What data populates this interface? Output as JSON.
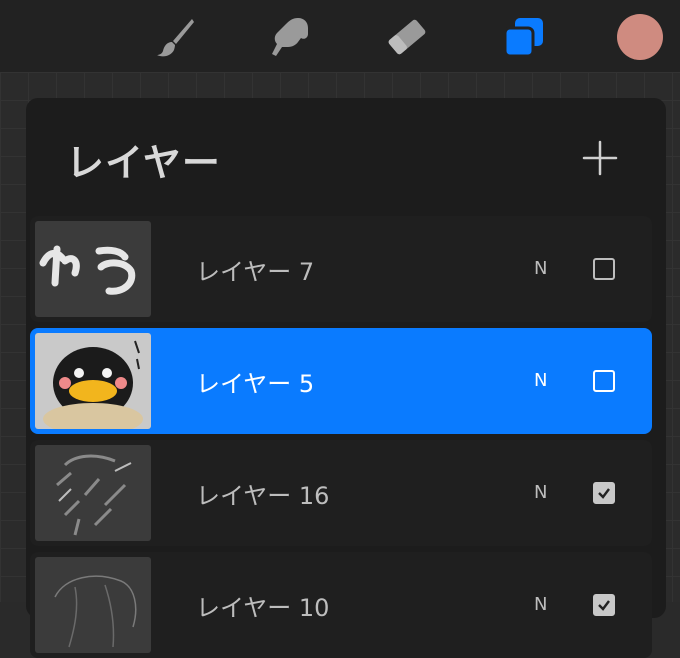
{
  "toolbar": {
    "tools": [
      {
        "name": "brush",
        "icon": "brush-icon",
        "active": false
      },
      {
        "name": "smudge",
        "icon": "smudge-icon",
        "active": false
      },
      {
        "name": "eraser",
        "icon": "eraser-icon",
        "active": false
      },
      {
        "name": "layers",
        "icon": "layers-icon",
        "active": true
      }
    ],
    "current_color": "#cf8b80",
    "active_color": "#0a7bff",
    "inactive_color": "#9a9a9a"
  },
  "layers_panel": {
    "title": "レイヤー",
    "add_icon": "plus-icon",
    "layers": [
      {
        "name": "レイヤー 7",
        "blend": "N",
        "visible": false,
        "selected": false,
        "thumb": "handwriting"
      },
      {
        "name": "レイヤー 5",
        "blend": "N",
        "visible": false,
        "selected": true,
        "thumb": "bird-character"
      },
      {
        "name": "レイヤー 16",
        "blend": "N",
        "visible": true,
        "selected": false,
        "thumb": "sketch-strokes"
      },
      {
        "name": "レイヤー 10",
        "blend": "N",
        "visible": true,
        "selected": false,
        "thumb": "line-sketch"
      }
    ]
  }
}
